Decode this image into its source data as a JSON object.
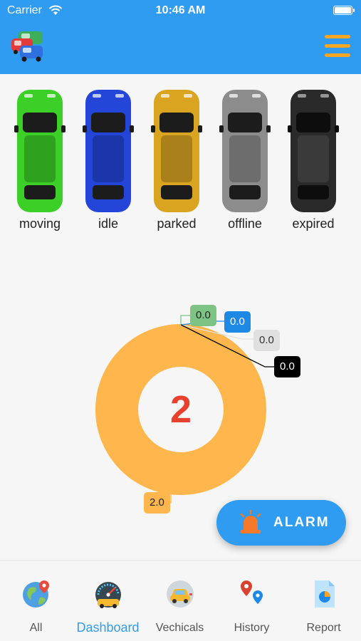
{
  "status_bar": {
    "carrier": "Carrier",
    "time": "10:46 AM"
  },
  "header": {
    "logo_icon": "cars-logo-icon",
    "menu_icon": "hamburger-menu-icon",
    "bar_color": "#2f9cf2",
    "menu_color": "#f5a623"
  },
  "vehicle_statuses": [
    {
      "label": "moving",
      "color": "#3ccf28"
    },
    {
      "label": "idle",
      "color": "#2346d8"
    },
    {
      "label": "parked",
      "color": "#d9a520"
    },
    {
      "label": "offline",
      "color": "#8c8c8c"
    },
    {
      "label": "expired",
      "color": "#2a2a2a"
    }
  ],
  "chart_data": {
    "type": "pie",
    "style": "donut",
    "center_value": "2",
    "slices": [
      {
        "status": "parked",
        "value": 2.0,
        "label": "2.0",
        "color": "#ffb74d"
      },
      {
        "status": "moving",
        "value": 0.0,
        "label": "0.0",
        "color": "#7dc383"
      },
      {
        "status": "idle",
        "value": 0.0,
        "label": "0.0",
        "color": "#1e88e5"
      },
      {
        "status": "offline",
        "value": 0.0,
        "label": "0.0",
        "color": "#e0e0e0"
      },
      {
        "status": "expired",
        "value": 0.0,
        "label": "0.0",
        "color": "#000000"
      }
    ]
  },
  "alarm": {
    "label": "ALARM",
    "icon": "siren-icon"
  },
  "bottom_nav": {
    "active": "Dashboard",
    "items": [
      {
        "label": "All",
        "icon": "globe-pin-icon"
      },
      {
        "label": "Dashboard",
        "icon": "speedometer-icon"
      },
      {
        "label": "Vechicals",
        "icon": "car-icon"
      },
      {
        "label": "History",
        "icon": "location-pins-icon"
      },
      {
        "label": "Report",
        "icon": "report-document-icon"
      }
    ]
  }
}
